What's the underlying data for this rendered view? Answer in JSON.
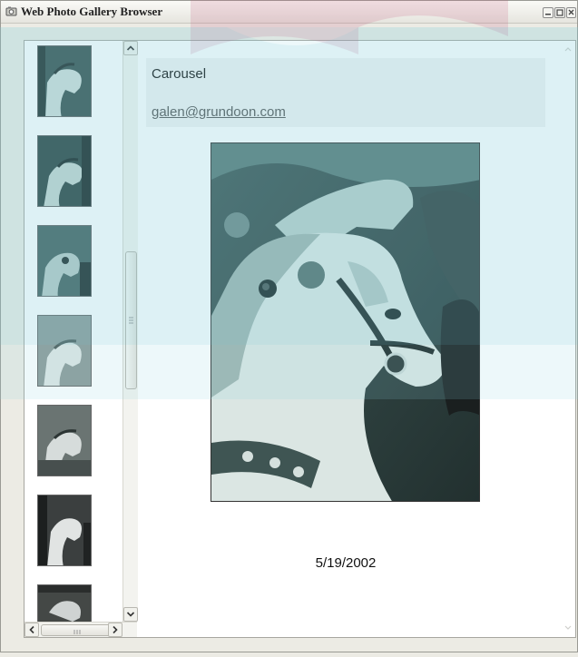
{
  "window": {
    "title": "Web Photo Gallery Browser"
  },
  "photo": {
    "title": "Carousel",
    "email": "galen@grundoon.com",
    "date": "5/19/2002"
  },
  "thumbnails": {
    "count_visible": 7
  },
  "icons": {
    "app": "camera-icon",
    "minimize": "minimize-icon",
    "maximize": "maximize-icon",
    "close": "close-icon",
    "scroll_up": "chevron-up-icon",
    "scroll_down": "chevron-down-icon",
    "scroll_left": "chevron-left-icon",
    "scroll_right": "chevron-right-icon"
  }
}
